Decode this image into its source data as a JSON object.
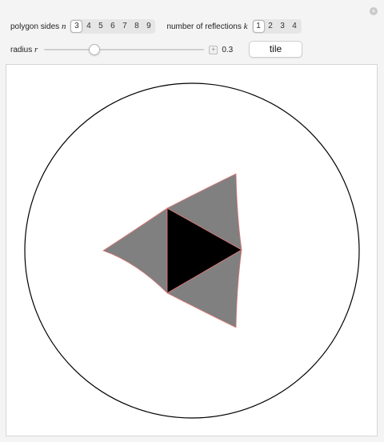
{
  "controls": {
    "polygon_sides": {
      "label_prefix": "polygon sides",
      "var": "n",
      "options": [
        "3",
        "4",
        "5",
        "6",
        "7",
        "8",
        "9"
      ],
      "selected": "3"
    },
    "reflections": {
      "label_prefix": "number of reflections",
      "var": "k",
      "options": [
        "1",
        "2",
        "3",
        "4"
      ],
      "selected": "1"
    },
    "radius": {
      "label_prefix": "radius",
      "var": "r",
      "value": "0.3",
      "slider_fraction": 0.3
    },
    "tile_button_label": "tile",
    "expand_icon": "plus-icon"
  },
  "colors": {
    "center_polygon": "#000000",
    "reflected_polygons": "#808080",
    "polygon_edges": "#e07a7a",
    "disk_boundary": "#000000"
  }
}
